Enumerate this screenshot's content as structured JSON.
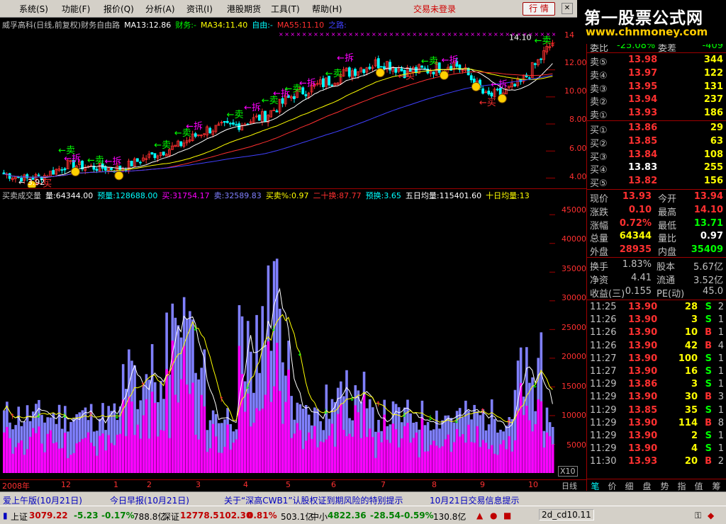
{
  "menu": [
    "系统(S)",
    "功能(F)",
    "报价(Q)",
    "分析(A)",
    "资讯(I)",
    "港股期货",
    "工具(T)",
    "帮助(H)"
  ],
  "trade_status": "交易未登录",
  "quote_button": "行 情",
  "logo": {
    "line1": "第一股票公式网",
    "line2": "www.chnmoney.com"
  },
  "price_info": {
    "title": "威孚高科(日线,前复权)财务自由路",
    "ma13": "MA13:12.86",
    "fin1": "财务:-",
    "ma34": "MA34:11.40",
    "fin2": "自由:-",
    "ma55": "MA55:11.10",
    "road": "之路:"
  },
  "price_axis": [
    "14",
    "12.00",
    "10.00",
    "8.00",
    "6.00",
    "4.00"
  ],
  "price_annotations": {
    "low": "3.92",
    "high": "14.10"
  },
  "price_signals": {
    "sell": "卖",
    "break": "拆",
    "buy": "买"
  },
  "vol_info": {
    "name": "买卖成交量",
    "vol": "量:64344.00",
    "pred": "预量:128688.00",
    "buy": "买:31754.17",
    "sell": "卖:32589.83",
    "bs_pct": "买卖%:0.97",
    "twenty": "二十换:87.77",
    "pred_turn": "预换:3.65",
    "ma5": "五日均量:115401.60",
    "ma10": "十日均量:13"
  },
  "vol_axis": [
    "45000",
    "40000",
    "35000",
    "30000",
    "25000",
    "20000",
    "15000",
    "10000",
    "5000"
  ],
  "vol_unit": "X10",
  "time_axis": [
    "2008年",
    "12",
    "1",
    "2",
    "3",
    "4",
    "5",
    "6",
    "7",
    "8",
    "9",
    "10"
  ],
  "period": "日线",
  "order_book": {
    "ratio_label": "委比",
    "ratio": "-25.08%",
    "diff_label": "委差",
    "diff": "-409",
    "sells": [
      {
        "label": "卖⑤",
        "price": "13.98",
        "vol": "344"
      },
      {
        "label": "卖④",
        "price": "13.97",
        "vol": "122"
      },
      {
        "label": "卖③",
        "price": "13.95",
        "vol": "131"
      },
      {
        "label": "卖②",
        "price": "13.94",
        "vol": "237"
      },
      {
        "label": "卖①",
        "price": "13.93",
        "vol": "186"
      }
    ],
    "buys": [
      {
        "label": "买①",
        "price": "13.86",
        "vol": "29"
      },
      {
        "label": "买②",
        "price": "13.85",
        "vol": "63"
      },
      {
        "label": "买③",
        "price": "13.84",
        "vol": "108"
      },
      {
        "label": "买④",
        "price": "13.83",
        "vol": "255"
      },
      {
        "label": "买⑤",
        "price": "13.82",
        "vol": "156"
      }
    ]
  },
  "stats": [
    {
      "l1": "现价",
      "v1": "13.93",
      "l2": "今开",
      "v2": "13.94"
    },
    {
      "l1": "涨跌",
      "v1": "0.10",
      "l2": "最高",
      "v2": "14.10"
    },
    {
      "l1": "涨幅",
      "v1": "0.72%",
      "l2": "最低",
      "v2": "13.71"
    },
    {
      "l1": "总量",
      "v1": "64344",
      "l2": "量比",
      "v2": "0.97"
    },
    {
      "l1": "外盘",
      "v1": "28935",
      "l2": "内盘",
      "v2": "35409"
    }
  ],
  "stats2": [
    {
      "l1": "换手",
      "v1": "1.83%",
      "l2": "股本",
      "v2": "5.67亿"
    },
    {
      "l1": "净资",
      "v1": "4.41",
      "l2": "流通",
      "v2": "3.52亿"
    },
    {
      "l1": "收益(三)",
      "v1": "0.155",
      "l2": "PE(动)",
      "v2": "45.0"
    }
  ],
  "ticks": [
    {
      "t": "11:25",
      "p": "13.90",
      "v": "28",
      "s": "S",
      "n": "2"
    },
    {
      "t": "11:26",
      "p": "13.90",
      "v": "3",
      "s": "S",
      "n": "1"
    },
    {
      "t": "11:26",
      "p": "13.90",
      "v": "10",
      "s": "B",
      "n": "1"
    },
    {
      "t": "11:26",
      "p": "13.90",
      "v": "42",
      "s": "B",
      "n": "4"
    },
    {
      "t": "11:27",
      "p": "13.90",
      "v": "100",
      "s": "S",
      "n": "1"
    },
    {
      "t": "11:27",
      "p": "13.90",
      "v": "16",
      "s": "S",
      "n": "1"
    },
    {
      "t": "11:29",
      "p": "13.86",
      "v": "3",
      "s": "S",
      "n": "1"
    },
    {
      "t": "11:29",
      "p": "13.90",
      "v": "30",
      "s": "B",
      "n": "3"
    },
    {
      "t": "11:29",
      "p": "13.85",
      "v": "35",
      "s": "S",
      "n": "1"
    },
    {
      "t": "11:29",
      "p": "13.90",
      "v": "114",
      "s": "B",
      "n": "8"
    },
    {
      "t": "11:29",
      "p": "13.90",
      "v": "2",
      "s": "S",
      "n": "1"
    },
    {
      "t": "11:29",
      "p": "13.90",
      "v": "4",
      "s": "S",
      "n": "1"
    },
    {
      "t": "11:30",
      "p": "13.93",
      "v": "20",
      "s": "B",
      "n": "2"
    }
  ],
  "tabs": [
    "笔",
    "价",
    "细",
    "盘",
    "势",
    "指",
    "值",
    "筹"
  ],
  "news": [
    "爱上午版(10月21日)",
    "今日早报(10月21日)",
    "关于“深高CWB1”认股权证到期风险的特别提示",
    "10月21日交易信息提示"
  ],
  "status": {
    "sh_label": "上证",
    "sh": "3079.22",
    "sh_chg": "-5.23",
    "sh_pct": "-0.17%",
    "sh_amt": "788.8亿",
    "sz_label": "深证",
    "sz": "12778.5",
    "sz_chg": "102.30",
    "sz_pct": "0.81%",
    "sz_amt": "503.1亿",
    "zx_label": "中小",
    "zx": "4822.36",
    "zx_chg": "-28.54",
    "zx_pct": "-0.59%",
    "zx_amt": "130.8亿",
    "file": "2d_cd10.11"
  },
  "colors": {
    "up": "#ff3030",
    "down": "#00ff00",
    "ma13": "#ffffff",
    "ma34": "#ffff00",
    "ma55": "#ff3030",
    "vol_buy": "#ff00ff",
    "vol_sell": "#8080ff"
  }
}
